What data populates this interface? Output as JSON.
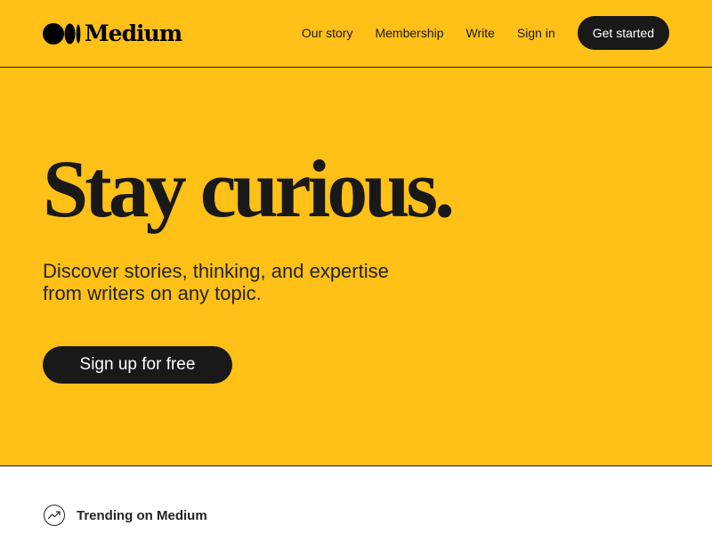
{
  "header": {
    "logo_text": "Medium",
    "nav": [
      {
        "label": "Our story"
      },
      {
        "label": "Membership"
      },
      {
        "label": "Write"
      },
      {
        "label": "Sign in"
      }
    ],
    "cta_label": "Get started"
  },
  "hero": {
    "title": "Stay curious.",
    "subtitle": "Discover stories, thinking, and expertise from writers on any topic.",
    "signup_label": "Sign up for free"
  },
  "trending": {
    "label": "Trending on Medium",
    "icon": "trending-up-icon"
  },
  "colors": {
    "brand_yellow": "#ffc017",
    "ink": "#191919",
    "background": "#ffffff"
  }
}
